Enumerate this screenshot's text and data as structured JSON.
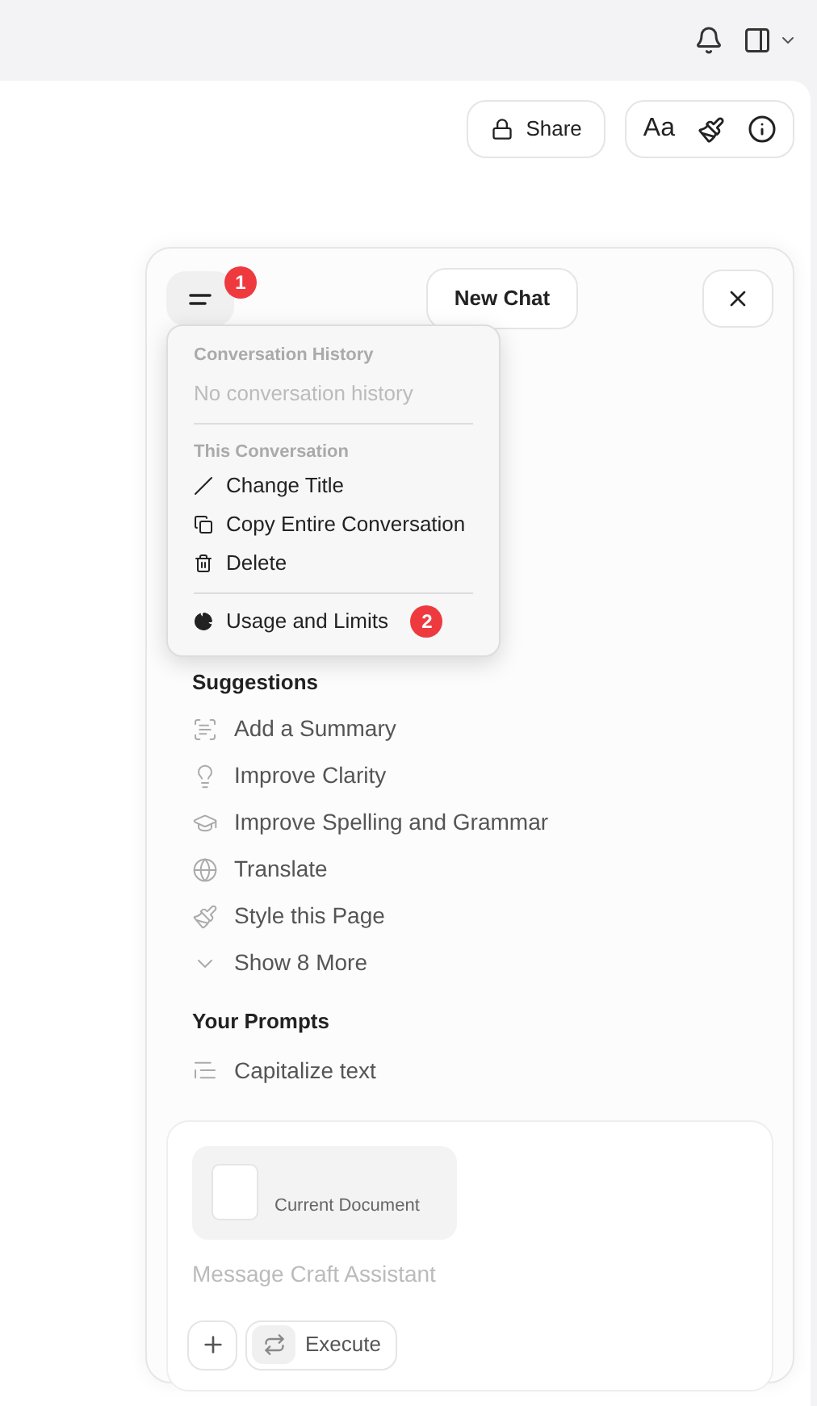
{
  "toolbar": {
    "share": "Share",
    "font_button": "Aa"
  },
  "chat": {
    "new_chat": "New Chat",
    "menu_badge": "1",
    "menu": {
      "history_heading": "Conversation History",
      "history_empty": "No conversation history",
      "conversation_heading": "This Conversation",
      "items": [
        "Change Title",
        "Copy Entire Conversation",
        "Delete"
      ],
      "usage": "Usage and Limits",
      "usage_badge": "2"
    },
    "suggestions_heading": "Suggestions",
    "suggestions": [
      "Add a Summary",
      "Improve Clarity",
      "Improve Spelling and Grammar",
      "Translate",
      "Style this Page",
      "Show 8 More"
    ],
    "prompts_heading": "Your Prompts",
    "prompts": [
      "Capitalize text"
    ],
    "composer": {
      "attachment": "Current Document",
      "placeholder": "Message Craft Assistant",
      "execute": "Execute"
    }
  }
}
